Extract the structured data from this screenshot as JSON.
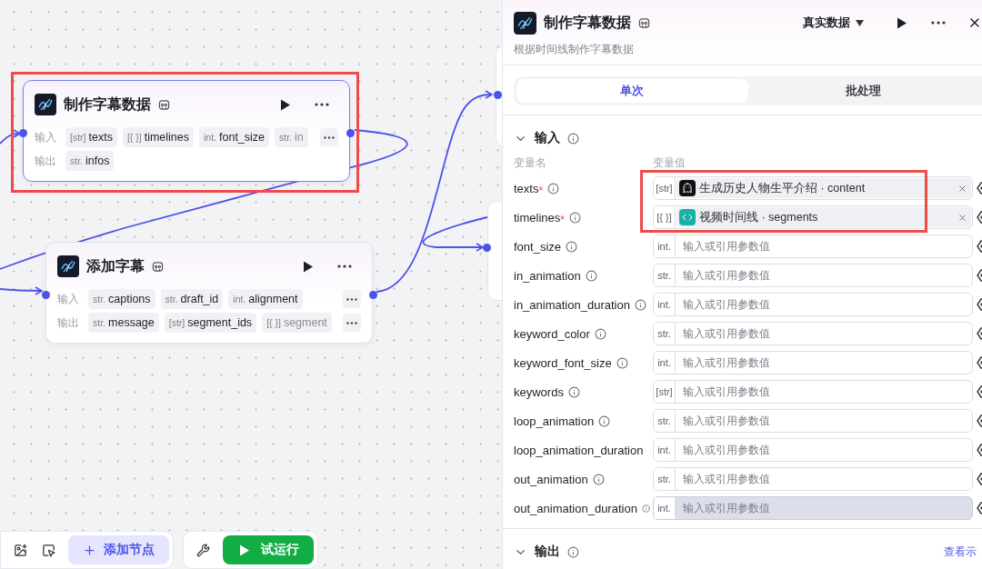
{
  "canvas": {
    "nodes": [
      {
        "title": "制作字幕数据",
        "selected": true,
        "highlighted": true,
        "inputs_label": "输入",
        "outputs_label": "输出",
        "inputs_overflow": true,
        "outputs_overflow": false,
        "inputs": [
          {
            "type": "[str]",
            "name": "texts",
            "faded": false
          },
          {
            "type": "[{ }]",
            "name": "timelines",
            "faded": false
          },
          {
            "type": "int.",
            "name": "font_size",
            "faded": false
          },
          {
            "type": "str.",
            "name": "in",
            "faded": true
          }
        ],
        "outputs": [
          {
            "type": "str.",
            "name": "infos",
            "faded": false
          }
        ]
      },
      {
        "title": "添加字幕",
        "selected": false,
        "highlighted": false,
        "inputs_label": "输入",
        "outputs_label": "输出",
        "inputs_overflow": true,
        "outputs_overflow": true,
        "inputs": [
          {
            "type": "str.",
            "name": "captions",
            "faded": false
          },
          {
            "type": "str.",
            "name": "draft_id",
            "faded": false
          },
          {
            "type": "int.",
            "name": "alignment",
            "faded": false
          }
        ],
        "outputs": [
          {
            "type": "str.",
            "name": "message",
            "faded": false
          },
          {
            "type": "[str]",
            "name": "segment_ids",
            "faded": false
          },
          {
            "type": "[{ }]",
            "name": "segment",
            "faded": true
          }
        ]
      }
    ]
  },
  "toolbar": {
    "add_node": "添加节点",
    "test_run": "试运行"
  },
  "panel": {
    "title": "制作字幕数据",
    "subtitle": "根据时间线制作字幕数据",
    "data_mode": "真实数据",
    "tabs": [
      {
        "label": "单次",
        "selected": true
      },
      {
        "label": "批处理",
        "selected": false
      }
    ],
    "input_section": {
      "title": "输入",
      "required_mark": "*",
      "name_header": "变量名",
      "value_header": "变量值",
      "highlighted": true,
      "params": [
        {
          "name": "texts",
          "required": true,
          "info": true,
          "type": "[str]",
          "highlighted": false,
          "value": {
            "kind": "bot",
            "node": "生成历史人物生平介绍",
            "separator": "·",
            "field": "content"
          }
        },
        {
          "name": "timelines",
          "required": true,
          "info": true,
          "type": "[{ }]",
          "highlighted": false,
          "value": {
            "kind": "code",
            "node": "视频时间线",
            "separator": "·",
            "field": "segments"
          }
        },
        {
          "name": "font_size",
          "required": false,
          "info": true,
          "type": "int.",
          "highlighted": false,
          "placeholder": "输入或引用参数值"
        },
        {
          "name": "in_animation",
          "required": false,
          "info": true,
          "type": "str.",
          "highlighted": false,
          "placeholder": "输入或引用参数值"
        },
        {
          "name": "in_animation_duration",
          "required": false,
          "info": true,
          "type": "int.",
          "highlighted": false,
          "placeholder": "输入或引用参数值"
        },
        {
          "name": "keyword_color",
          "required": false,
          "info": true,
          "type": "str.",
          "highlighted": false,
          "placeholder": "输入或引用参数值"
        },
        {
          "name": "keyword_font_size",
          "required": false,
          "info": true,
          "type": "int.",
          "highlighted": false,
          "placeholder": "输入或引用参数值"
        },
        {
          "name": "keywords",
          "required": false,
          "info": true,
          "type": "[str]",
          "highlighted": false,
          "placeholder": "输入或引用参数值"
        },
        {
          "name": "loop_animation",
          "required": false,
          "info": true,
          "type": "str.",
          "highlighted": false,
          "placeholder": "输入或引用参数值"
        },
        {
          "name": "loop_animation_duration",
          "required": false,
          "info": false,
          "type": "int.",
          "highlighted": false,
          "placeholder": "输入或引用参数值"
        },
        {
          "name": "out_animation",
          "required": false,
          "info": true,
          "type": "str.",
          "highlighted": false,
          "placeholder": "输入或引用参数值"
        },
        {
          "name": "out_animation_duration",
          "required": false,
          "info": true,
          "type": "int.",
          "highlighted": true,
          "placeholder": "输入或引用参数值"
        }
      ]
    },
    "output_section": {
      "title": "输出",
      "link": "查看示"
    }
  }
}
